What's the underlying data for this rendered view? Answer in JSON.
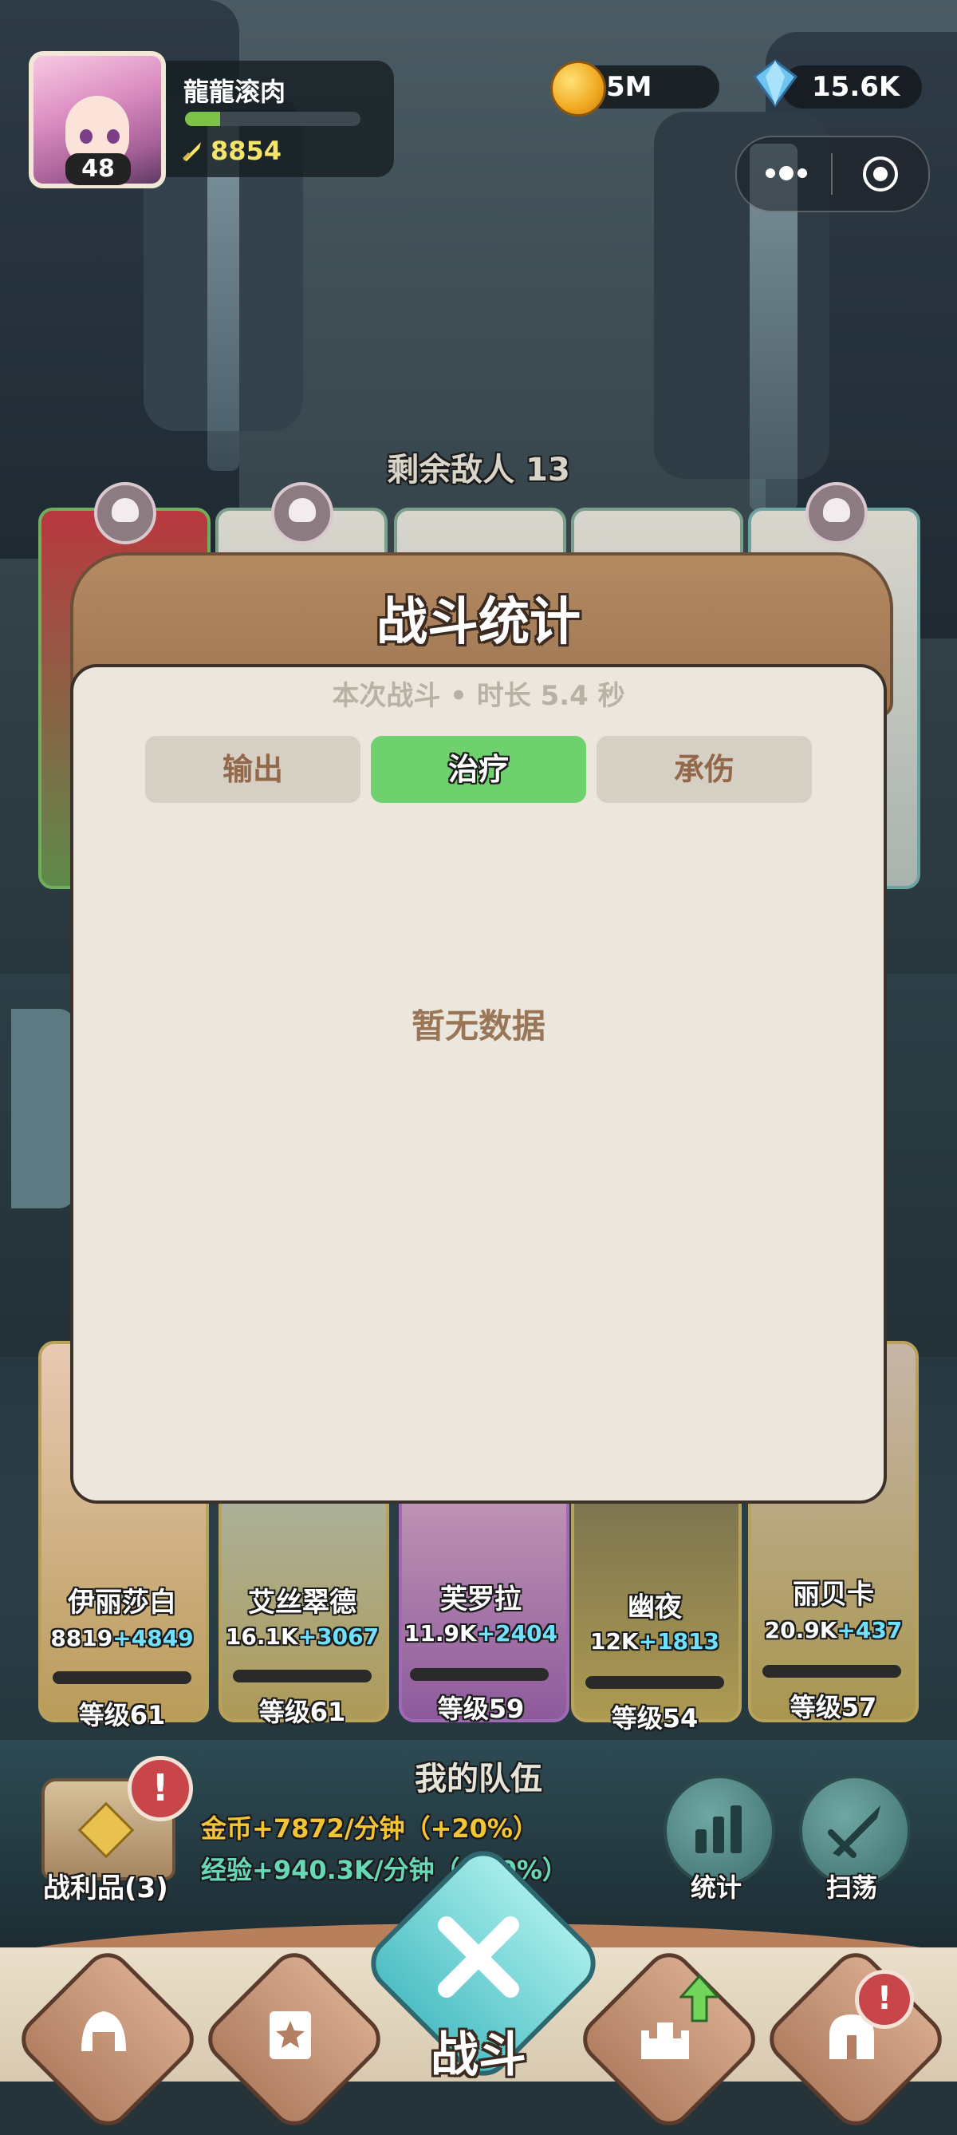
{
  "player": {
    "name": "龍龍滚肉",
    "level": "48",
    "power": "8854",
    "xp_progress": 0.2
  },
  "currency": {
    "gold": "5M",
    "gems": "15.6K"
  },
  "battle": {
    "enemies_remaining": "剩余敌人 13"
  },
  "stats_modal": {
    "title": "战斗统计",
    "subtitle": "本次战斗 • 时长 5.4 秒",
    "tabs": [
      {
        "label": "输出",
        "active": false
      },
      {
        "label": "治疗",
        "active": true
      },
      {
        "label": "承伤",
        "active": false
      }
    ],
    "empty_text": "暂无数据"
  },
  "team": {
    "title": "我的队伍",
    "heroes": [
      {
        "name": "伊丽莎白",
        "power": "8819",
        "bonus": "+4849",
        "level": "等级61"
      },
      {
        "name": "艾丝翠德",
        "power": "16.1K",
        "bonus": "+3067",
        "level": "等级61"
      },
      {
        "name": "芙罗拉",
        "power": "11.9K",
        "bonus": "+2404",
        "level": "等级59"
      },
      {
        "name": "幽夜",
        "power": "12K",
        "bonus": "+1813",
        "level": "等级54"
      },
      {
        "name": "丽贝卡",
        "power": "20.9K",
        "bonus": "+437",
        "level": "等级57"
      }
    ]
  },
  "rewards": {
    "loot_label": "战利品(3)",
    "alert": "!",
    "gold_rate": "金币+7872/分钟（+20%）",
    "exp_rate": "经验+940.3K/分钟（+20%）"
  },
  "actions": {
    "stats_label": "统计",
    "sweep_label": "扫荡"
  },
  "nav": {
    "fight_label": "战斗"
  },
  "colors": {
    "active_tab": "#6fd16e",
    "modal_header": "#a67d58",
    "modal_body": "#ebe7dd"
  }
}
